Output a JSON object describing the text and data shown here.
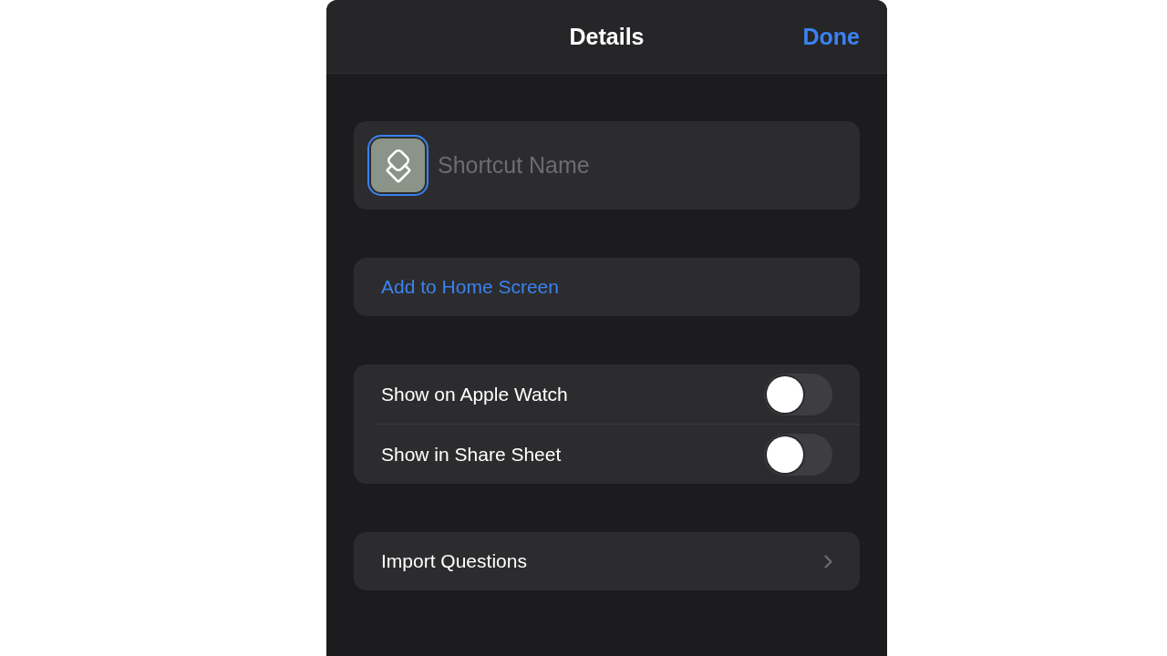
{
  "header": {
    "title": "Details",
    "done_button": "Done"
  },
  "name_field": {
    "icon": {
      "selected": true
    },
    "placeholder": "Shortcut Name"
  },
  "add_to_home_screen": {
    "label": "Add to Home Screen"
  },
  "toggles": [
    {
      "label": "Show on Apple Watch",
      "on": false
    },
    {
      "label": "Show in Share Sheet",
      "on": false
    }
  ],
  "import_questions": {
    "label": "Import Questions"
  }
}
